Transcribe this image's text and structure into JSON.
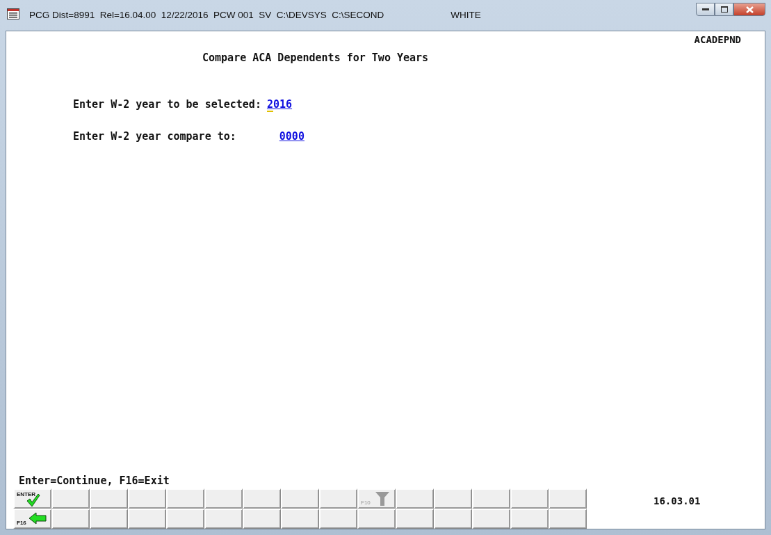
{
  "window": {
    "title": "PCG Dist=8991  Rel=16.04.00  12/22/2016  PCW 001  SV  C:\\DEVSYS  C:\\SECOND",
    "user": "WHITE"
  },
  "screen_id": "ACADEPND",
  "heading": "Compare ACA Dependents for Two Years",
  "fields": [
    {
      "label": "Enter W-2 year to be selected:",
      "value": "2016",
      "focused": true
    },
    {
      "label": "Enter W-2 year compare to:",
      "value": "0000",
      "focused": false
    }
  ],
  "hint": "Enter=Continue, F16=Exit",
  "function_keys": [
    [
      {
        "kind": "enter",
        "label": "ENTER",
        "disabled": false
      },
      {
        "kind": "empty"
      },
      {
        "kind": "empty"
      },
      {
        "kind": "empty"
      },
      {
        "kind": "empty"
      },
      {
        "kind": "empty"
      },
      {
        "kind": "empty"
      },
      {
        "kind": "empty"
      },
      {
        "kind": "empty"
      },
      {
        "kind": "filter",
        "label": "F10",
        "disabled": true
      },
      {
        "kind": "empty"
      },
      {
        "kind": "empty"
      },
      {
        "kind": "empty"
      },
      {
        "kind": "empty"
      },
      {
        "kind": "empty"
      }
    ],
    [
      {
        "kind": "back",
        "label": "F16",
        "disabled": false
      },
      {
        "kind": "empty"
      },
      {
        "kind": "empty"
      },
      {
        "kind": "empty"
      },
      {
        "kind": "empty"
      },
      {
        "kind": "empty"
      },
      {
        "kind": "empty"
      },
      {
        "kind": "empty"
      },
      {
        "kind": "empty"
      },
      {
        "kind": "empty"
      },
      {
        "kind": "empty"
      },
      {
        "kind": "empty"
      },
      {
        "kind": "empty"
      },
      {
        "kind": "empty"
      },
      {
        "kind": "empty"
      }
    ]
  ],
  "version": "16.03.01"
}
